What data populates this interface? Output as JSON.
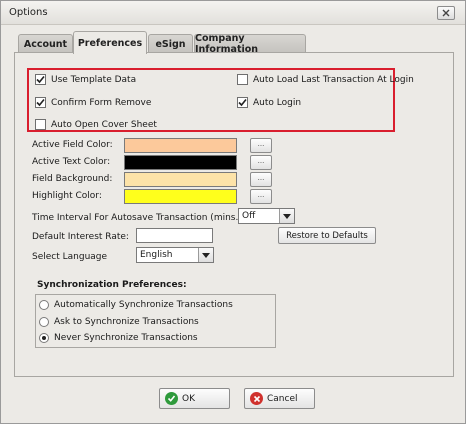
{
  "window": {
    "title": "Options"
  },
  "tabs": [
    {
      "label": "Account"
    },
    {
      "label": "Preferences"
    },
    {
      "label": "eSign"
    },
    {
      "label": "Company Information"
    }
  ],
  "checkboxes": [
    {
      "label": "Use Template Data",
      "checked": true
    },
    {
      "label": "Auto Load Last Transaction At Login",
      "checked": false
    },
    {
      "label": "Confirm Form Remove",
      "checked": true
    },
    {
      "label": "Auto Login",
      "checked": true
    },
    {
      "label": "Auto Open Cover Sheet",
      "checked": false
    }
  ],
  "colors": {
    "active_field": {
      "label": "Active Field Color:",
      "value": "#fcc99b"
    },
    "active_text": {
      "label": "Active Text Color:",
      "value": "#000000"
    },
    "field_background": {
      "label": "Field Background:",
      "value": "#fde3a8"
    },
    "highlight": {
      "label": "Highlight Color:",
      "value": "#ffff1c"
    },
    "button_label": "..."
  },
  "autosave": {
    "label": "Time Interval For Autosave Transaction (mins.):",
    "value": "Off"
  },
  "interest": {
    "label": "Default Interest Rate:",
    "value": ""
  },
  "restore_button": "Restore to Defaults",
  "language": {
    "label": "Select Language",
    "value": "English"
  },
  "sync": {
    "title": "Synchronization Preferences:",
    "options": [
      {
        "label": "Automatically Synchronize Transactions",
        "selected": false
      },
      {
        "label": "Ask to Synchronize Transactions",
        "selected": false
      },
      {
        "label": "Never Synchronize Transactions",
        "selected": true
      }
    ]
  },
  "footer": {
    "ok": "OK",
    "cancel": "Cancel"
  },
  "accent": {
    "highlight_frame": "#d91e2e",
    "ok_icon": "#2e9a3c",
    "cancel_icon": "#d0312d"
  }
}
